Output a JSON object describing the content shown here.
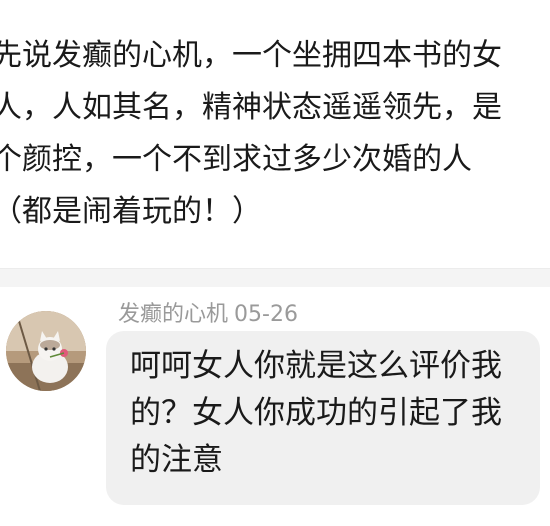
{
  "post": {
    "lines": [
      "先说发癫的心机，一个坐拥四本书的女",
      "人，人如其名，精神状态遥遥领先，是",
      "个颜控，一个不到求过多少次婚的人",
      "（都是闹着玩的！）"
    ]
  },
  "comment": {
    "author": "发癫的心机",
    "date": "05-26",
    "avatar_icon": "cat-photo-avatar",
    "lines": [
      "呵呵女人你就是这么评价我",
      "的？女人你成功的引起了我",
      "的注意"
    ]
  },
  "colors": {
    "background": "#ffffff",
    "divider": "#f4f4f4",
    "bubble": "#f0f0f0",
    "meta_text": "#9a9a9a",
    "body_text": "#1a1a1a"
  }
}
